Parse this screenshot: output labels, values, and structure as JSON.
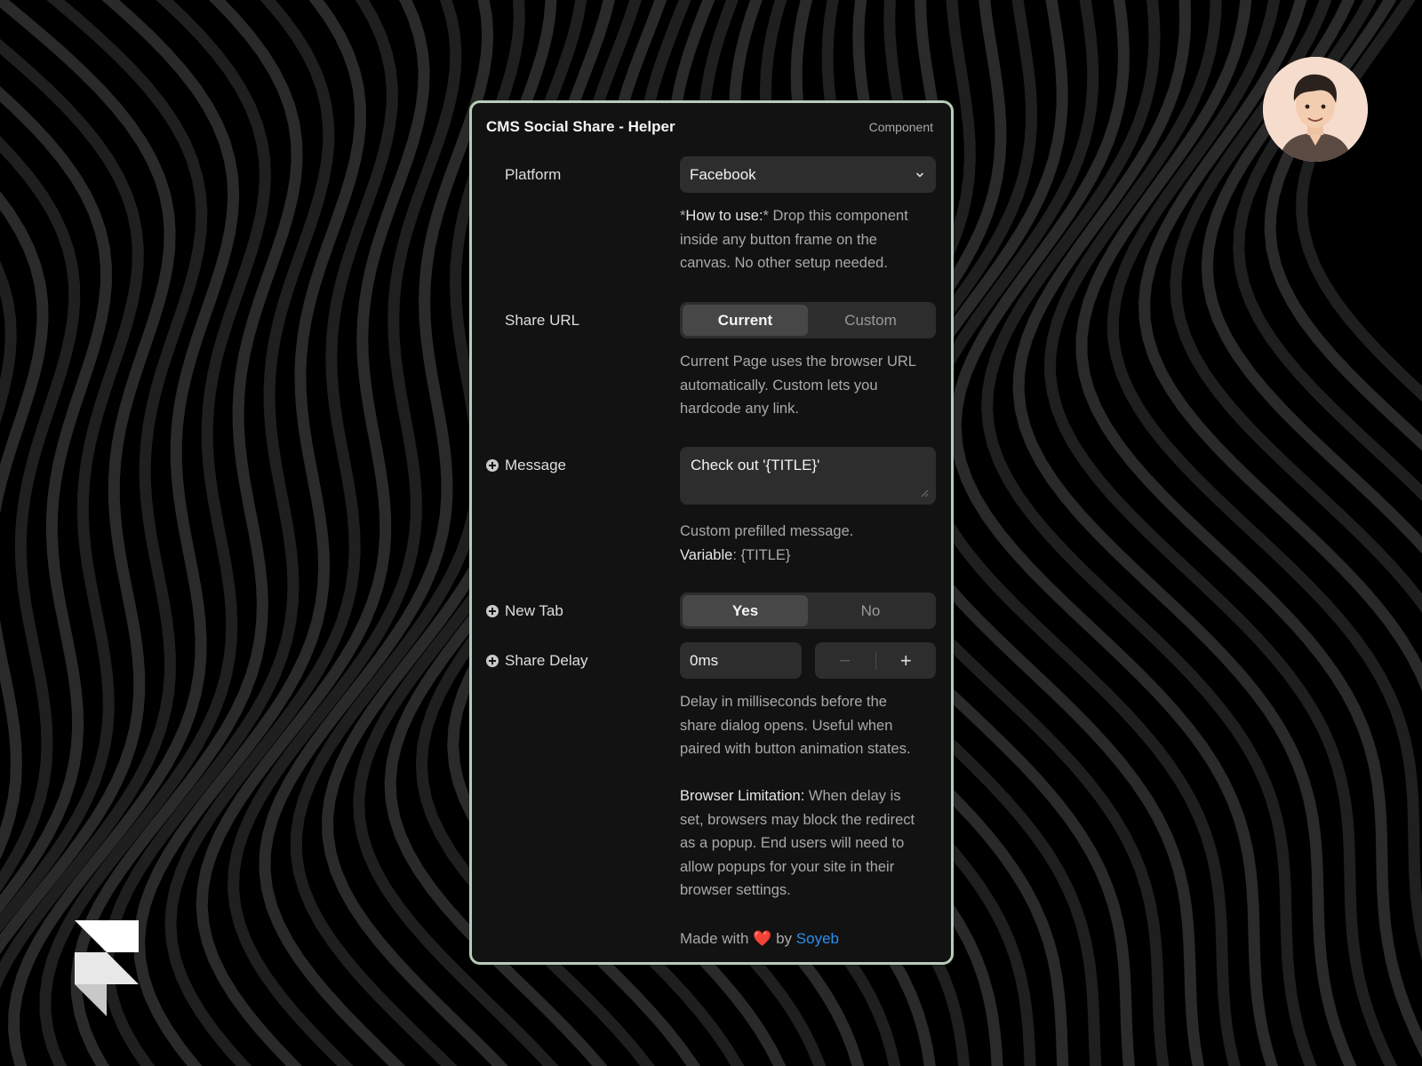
{
  "panel": {
    "title": "CMS Social Share - Helper",
    "tag": "Component"
  },
  "platform": {
    "label": "Platform",
    "value": "Facebook",
    "help_bold": "How to use:",
    "help_prefix": "*",
    "help_suffix": "*",
    "help_line1_rest": " Drop this component",
    "help_line2": "inside any button frame on the",
    "help_line3": "canvas. No other setup needed."
  },
  "share_url": {
    "label": "Share URL",
    "options": [
      "Current",
      "Custom"
    ],
    "selected": "Current",
    "help": [
      "Current Page uses the browser URL",
      "automatically. Custom lets you",
      "hardcode any link."
    ]
  },
  "message": {
    "label": "Message",
    "value": "Check out '{TITLE}'",
    "help_line1": "Custom prefilled message.",
    "help_var_label": "Variable",
    "help_var_value": ": {TITLE}"
  },
  "new_tab": {
    "label": "New Tab",
    "options": [
      "Yes",
      "No"
    ],
    "selected": "Yes"
  },
  "share_delay": {
    "label": "Share Delay",
    "value": "0ms",
    "minus": "−",
    "plus": "+",
    "help": [
      "Delay in milliseconds before the",
      "share dialog opens. Useful when",
      "paired with button animation states."
    ],
    "limit_bold": "Browser Limitation:",
    "limit_line1_rest": " When delay is",
    "limit_lines": [
      "set, browsers may block the redirect",
      "as a popup. End users will need to",
      "allow popups for your site in their",
      "browser settings."
    ]
  },
  "footer": {
    "made_with": "Made with ",
    "heart": "❤️",
    "by": " by ",
    "author": "Soyeb"
  },
  "colors": {
    "background": "#000000",
    "panel": "#121212",
    "panel_border": "#b9cbb9",
    "control": "#2d2d2d",
    "link": "#2e8ff0"
  },
  "icons": [
    "chevron-down-icon",
    "plus-circle-icon",
    "resize-grip-icon",
    "minus-icon",
    "plus-icon",
    "framer-logo",
    "avatar"
  ]
}
